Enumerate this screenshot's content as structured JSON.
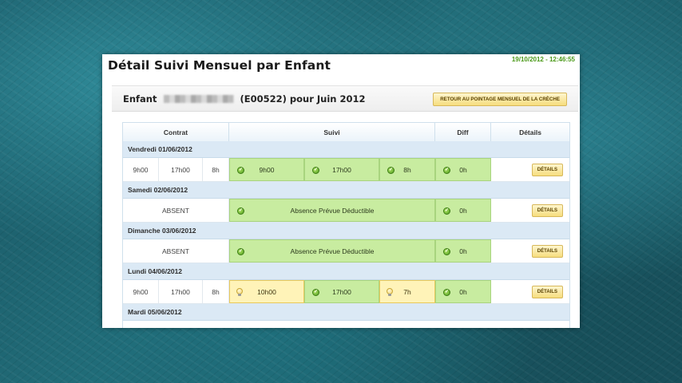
{
  "page": {
    "title": "Détail Suivi Mensuel par Enfant",
    "timestamp": "19/10/2012 - 12:46:55"
  },
  "panel": {
    "child_prefix": "Enfant",
    "child_code": "(E00522)",
    "period": "pour Juin 2012",
    "back_button": "RETOUR AU POINTAGE MENSUEL DE LA CRÈCHE"
  },
  "table": {
    "headers": {
      "contrat": "Contrat",
      "suivi": "Suivi",
      "diff": "Diff",
      "details": "Détails"
    },
    "details_label": "DÉTAILS",
    "days": [
      {
        "date": "Vendredi 01/06/2012",
        "contract": {
          "start": "9h00",
          "end": "17h00",
          "hours": "8h"
        },
        "tracking": [
          {
            "value": "9h00",
            "status": "ok"
          },
          {
            "value": "17h00",
            "status": "ok"
          },
          {
            "value": "8h",
            "status": "ok"
          }
        ],
        "diff": "0h"
      },
      {
        "date": "Samedi 02/06/2012",
        "contract_text": "ABSENT",
        "tracking_text": "Absence Prévue Déductible",
        "diff": "0h"
      },
      {
        "date": "Dimanche 03/06/2012",
        "contract_text": "ABSENT",
        "tracking_text": "Absence Prévue Déductible",
        "diff": "0h"
      },
      {
        "date": "Lundi 04/06/2012",
        "contract": {
          "start": "9h00",
          "end": "17h00",
          "hours": "8h"
        },
        "tracking": [
          {
            "value": "10h00",
            "status": "warn"
          },
          {
            "value": "17h00",
            "status": "ok"
          },
          {
            "value": "7h",
            "status": "warn"
          }
        ],
        "diff": "0h"
      },
      {
        "date": "Mardi 05/06/2012"
      }
    ]
  },
  "colors": {
    "ok_fill": "#c8eca0",
    "warn_fill": "#fff3b8",
    "timestamp_green": "#4c9a1a",
    "header_blue": "#dbe9f5"
  },
  "icons": {
    "ok": "check-circle-icon",
    "warn": "lightbulb-icon"
  }
}
